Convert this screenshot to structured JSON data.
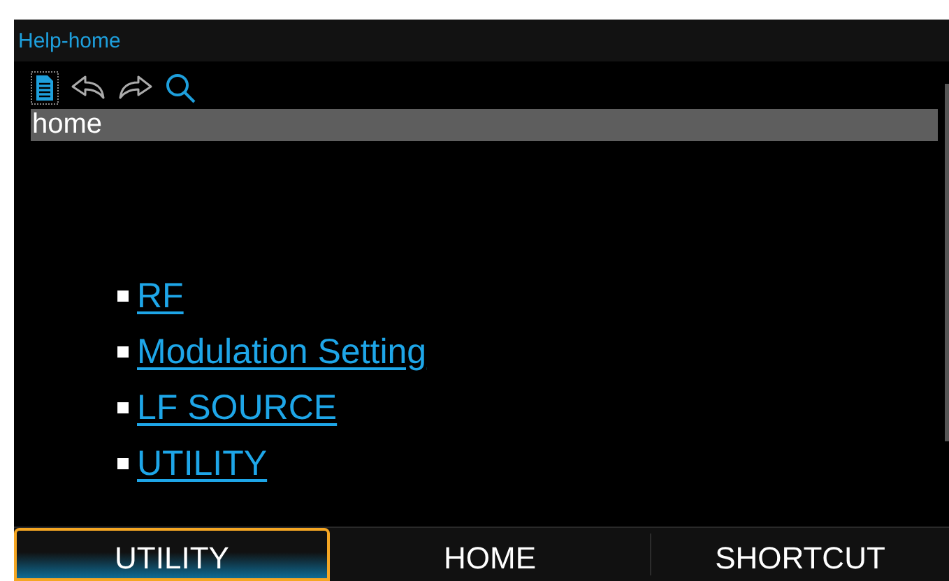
{
  "window": {
    "title": "Help-home"
  },
  "toolbar": {
    "location": "home"
  },
  "links": [
    {
      "label": "RF"
    },
    {
      "label": "Modulation Setting"
    },
    {
      "label": "LF SOURCE"
    },
    {
      "label": "UTILITY"
    }
  ],
  "softkeys": [
    {
      "label": "UTILITY",
      "selected": true
    },
    {
      "label": "HOME",
      "selected": false
    },
    {
      "label": "SHORTCUT",
      "selected": false
    }
  ]
}
